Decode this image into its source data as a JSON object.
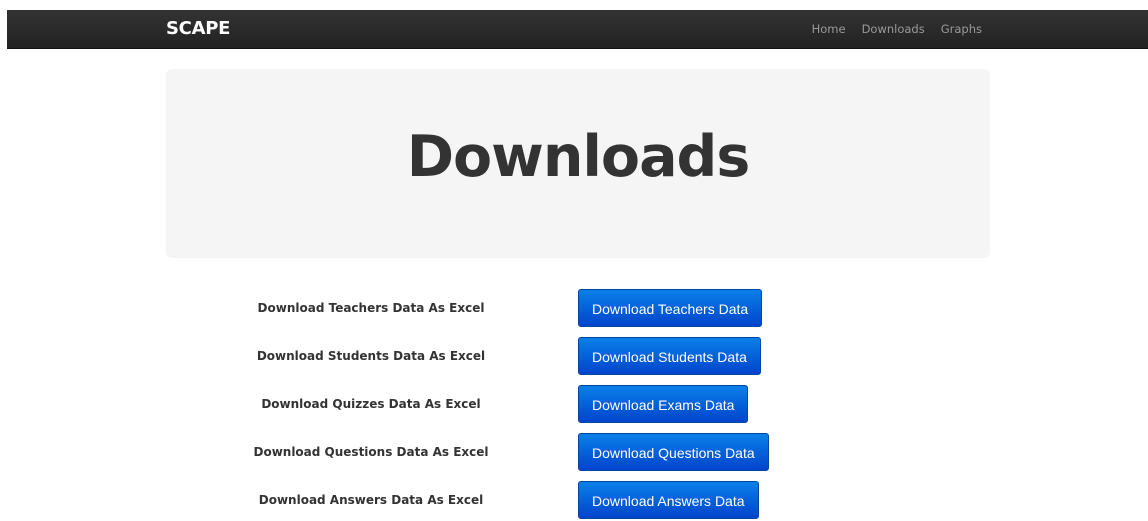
{
  "navbar": {
    "brand": "SCAPE",
    "links": [
      "Home",
      "Downloads",
      "Graphs"
    ]
  },
  "hero": {
    "title": "Downloads"
  },
  "downloads": [
    {
      "label": "Download Teachers Data As Excel",
      "button": "Download Teachers Data"
    },
    {
      "label": "Download Students Data As Excel",
      "button": "Download Students Data"
    },
    {
      "label": "Download Quizzes Data As Excel",
      "button": "Download Exams Data"
    },
    {
      "label": "Download Questions Data As Excel",
      "button": "Download Questions Data"
    },
    {
      "label": "Download Answers Data As Excel",
      "button": "Download Answers Data"
    }
  ],
  "colors": {
    "navbar": "#222222",
    "button": "#0066d6",
    "hero_bg": "#f5f5f5"
  }
}
